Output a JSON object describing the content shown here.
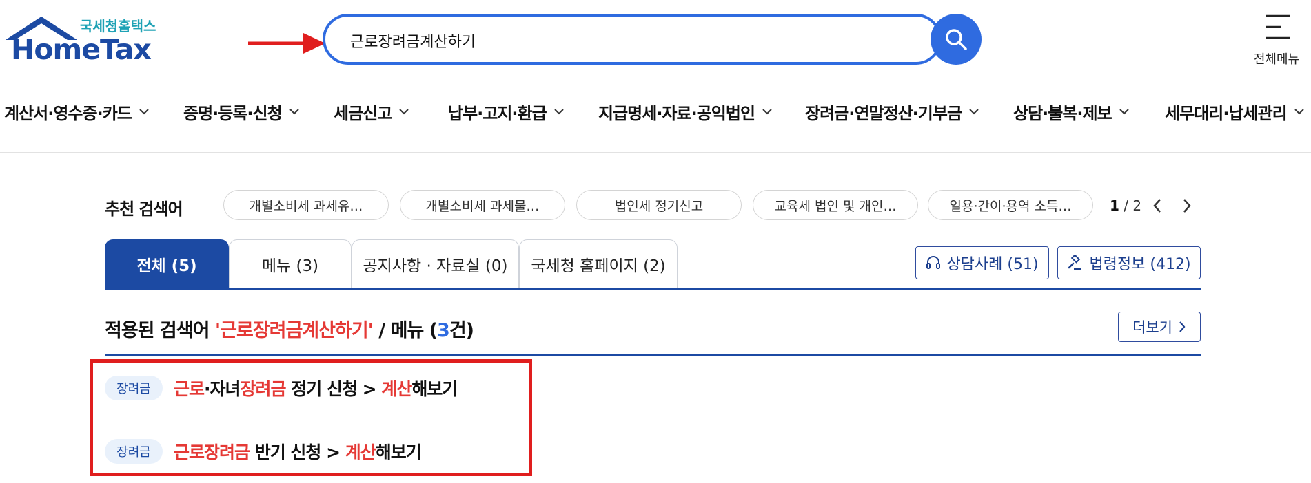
{
  "logo": {
    "korean": "국세청홈택스",
    "english": "HomeTax"
  },
  "search": {
    "value": "근로장려금계산하기",
    "placeholder": ""
  },
  "all_menu": {
    "label": "전체메뉴"
  },
  "nav": [
    {
      "label": "계산서·영수증·카드"
    },
    {
      "label": "증명·등록·신청"
    },
    {
      "label": "세금신고"
    },
    {
      "label": "납부·고지·환급"
    },
    {
      "label": "지급명세·자료·공익법인"
    },
    {
      "label": "장려금·연말정산·기부금"
    },
    {
      "label": "상담·불복·제보"
    },
    {
      "label": "세무대리·납세관리"
    }
  ],
  "recommended": {
    "title": "추천 검색어",
    "chips": [
      "개별소비세 과세유…",
      "개별소비세 과세물…",
      "법인세 정기신고",
      "교육세 법인 및 개인…",
      "일용·간이·용역 소득…"
    ],
    "page_current": "1",
    "page_sep": " / ",
    "page_total": "2"
  },
  "tabs": [
    {
      "label": "전체 (5)",
      "active": true
    },
    {
      "label": "메뉴 (3)",
      "active": false
    },
    {
      "label": "공지사항 · 자료실 (0)",
      "active": false
    },
    {
      "label": "국세청 홈페이지 (2)",
      "active": false
    }
  ],
  "tools": {
    "consult_label": "상담사례 (51)",
    "law_label": "법령정보 (412)"
  },
  "result_heading": {
    "prefix": "적용된 검색어 ",
    "keyword": "'근로장려금계산하기'",
    "middle": " / 메뉴 (",
    "count": "3",
    "suffix": "건)"
  },
  "more_label": "더보기",
  "results": [
    {
      "badge": "장려금",
      "parts": [
        {
          "text": "근로",
          "hl": true
        },
        {
          "text": "·자녀",
          "hl": false
        },
        {
          "text": "장려금",
          "hl": true
        },
        {
          "text": " 정기 신청 > ",
          "hl": false
        },
        {
          "text": "계산",
          "hl": true
        },
        {
          "text": "해보기",
          "hl": false
        }
      ]
    },
    {
      "badge": "장려금",
      "parts": [
        {
          "text": "근로장려금",
          "hl": true
        },
        {
          "text": " 반기 신청 > ",
          "hl": false
        },
        {
          "text": "계산",
          "hl": true
        },
        {
          "text": "해보기",
          "hl": false
        }
      ]
    }
  ],
  "colors": {
    "brand_blue": "#1c4aa3",
    "search_blue": "#2f6be0",
    "highlight_red": "#e53935",
    "logo_teal": "#1fa2b5"
  }
}
